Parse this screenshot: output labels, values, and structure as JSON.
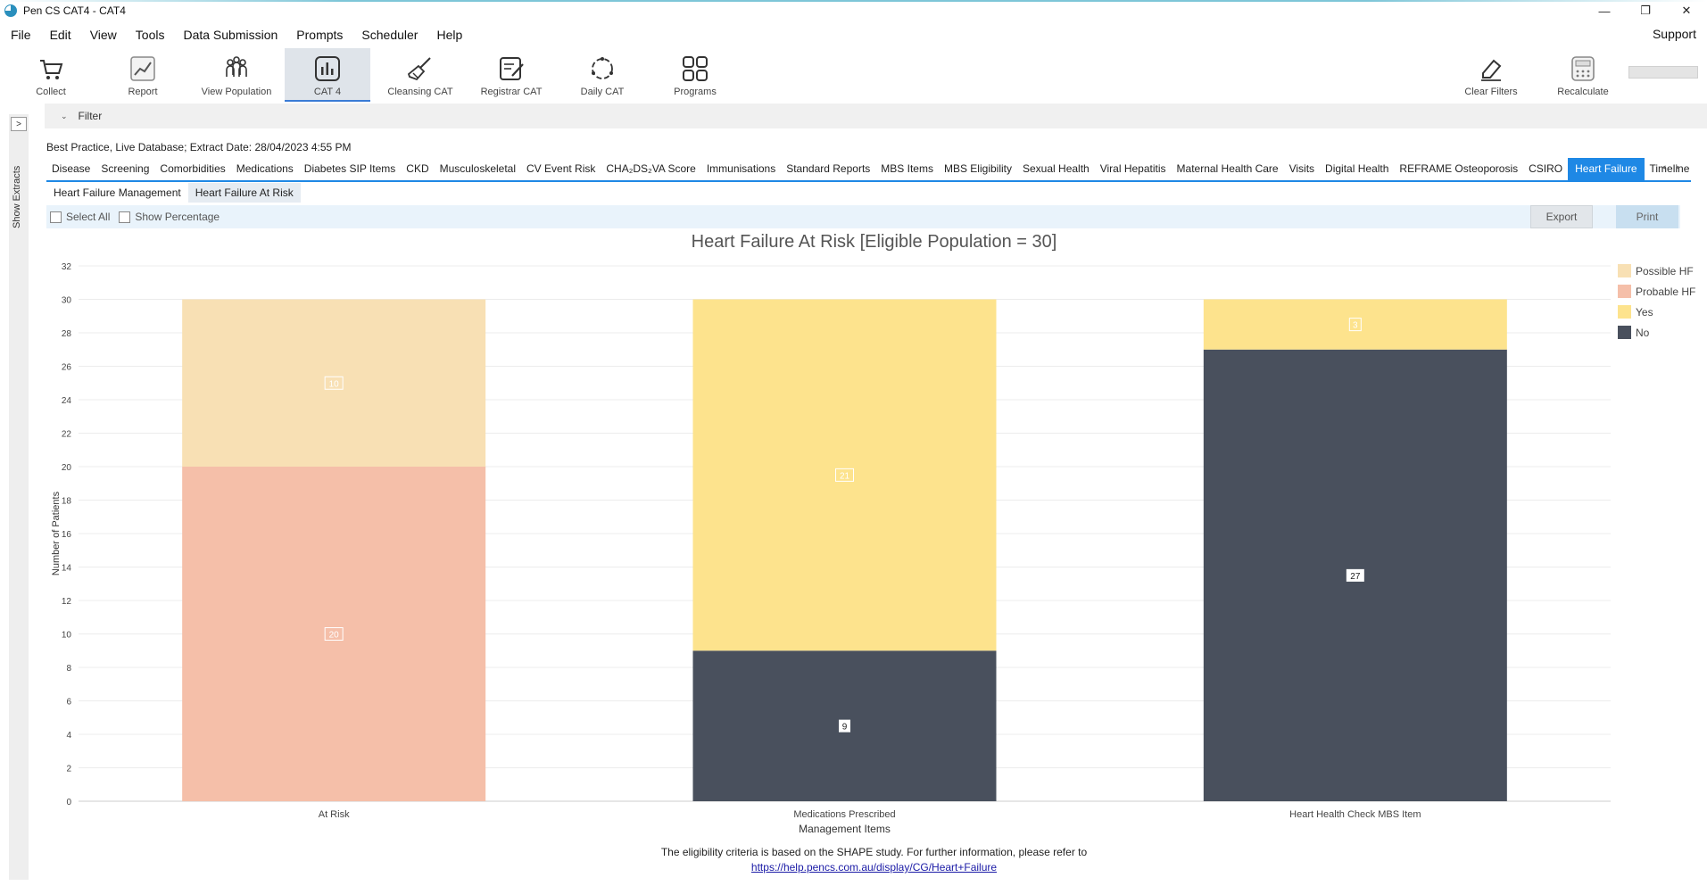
{
  "window": {
    "title": "Pen CS CAT4 - CAT4",
    "controls": [
      "—",
      "❐",
      "✕"
    ]
  },
  "menu": {
    "items": [
      "File",
      "Edit",
      "View",
      "Tools",
      "Data Submission",
      "Prompts",
      "Scheduler",
      "Help"
    ],
    "support": "Support"
  },
  "toolbar": {
    "collect": "Collect",
    "report": "Report",
    "view_population": "View Population",
    "cat4": "CAT 4",
    "cleansing": "Cleansing CAT",
    "registrar": "Registrar CAT",
    "daily": "Daily CAT",
    "programs": "Programs",
    "clear_filters": "Clear Filters",
    "recalculate": "Recalculate"
  },
  "left_panel": {
    "label": "Show Extracts",
    "toggle": ">"
  },
  "filter": {
    "label": "Filter"
  },
  "extract_info": "Best Practice, Live Database; Extract Date: 28/04/2023 4:55 PM",
  "main_tabs": [
    "Disease",
    "Screening",
    "Comorbidities",
    "Medications",
    "Diabetes SIP Items",
    "CKD",
    "Musculoskeletal",
    "CV Event Risk",
    "CHA₂DS₂VA Score",
    "Immunisations",
    "Standard Reports",
    "MBS Items",
    "MBS Eligibility",
    "Sexual Health",
    "Viral Hepatitis",
    "Maternal Health Care",
    "Visits",
    "Digital Health",
    "REFRAME Osteoporosis",
    "CSIRO",
    "Heart Failure",
    "Timeline"
  ],
  "main_tabs_active": "Heart Failure",
  "sub_tabs": [
    "Heart Failure Management",
    "Heart Failure At Risk"
  ],
  "sub_tabs_active": "Heart Failure At Risk",
  "options": {
    "select_all": "Select All",
    "show_percentage": "Show Percentage",
    "export": "Export",
    "print": "Print"
  },
  "footnote": "The eligibility criteria is based on the SHAPE study. For further information, please refer to",
  "footnote_link": "https://help.pencs.com.au/display/CG/Heart+Failure",
  "colors": {
    "possible_hf": "#f8e0b4",
    "probable_hf": "#f5bfa9",
    "yes": "#fde38d",
    "no": "#49505d",
    "accent": "#1e88e5"
  },
  "chart_data": {
    "type": "bar",
    "stacked": true,
    "title": "Heart Failure At Risk [Eligible Population = 30]",
    "xlabel": "Management Items",
    "ylabel": "Number of Patients",
    "ylim": [
      0,
      32
    ],
    "yticks": [
      0,
      2,
      4,
      6,
      8,
      10,
      12,
      14,
      16,
      18,
      20,
      22,
      24,
      26,
      28,
      30,
      32
    ],
    "categories": [
      "At Risk",
      "Medications Prescribed",
      "Heart Health Check MBS Item"
    ],
    "series": [
      {
        "name": "No",
        "values": [
          0,
          9,
          27
        ]
      },
      {
        "name": "Probable HF",
        "values": [
          20,
          0,
          0
        ]
      },
      {
        "name": "Yes",
        "values": [
          0,
          21,
          3
        ]
      },
      {
        "name": "Possible HF",
        "values": [
          10,
          0,
          0
        ]
      }
    ],
    "legend": [
      "Possible HF",
      "Probable HF",
      "Yes",
      "No"
    ],
    "legend_position": "top-right",
    "grid": true
  }
}
